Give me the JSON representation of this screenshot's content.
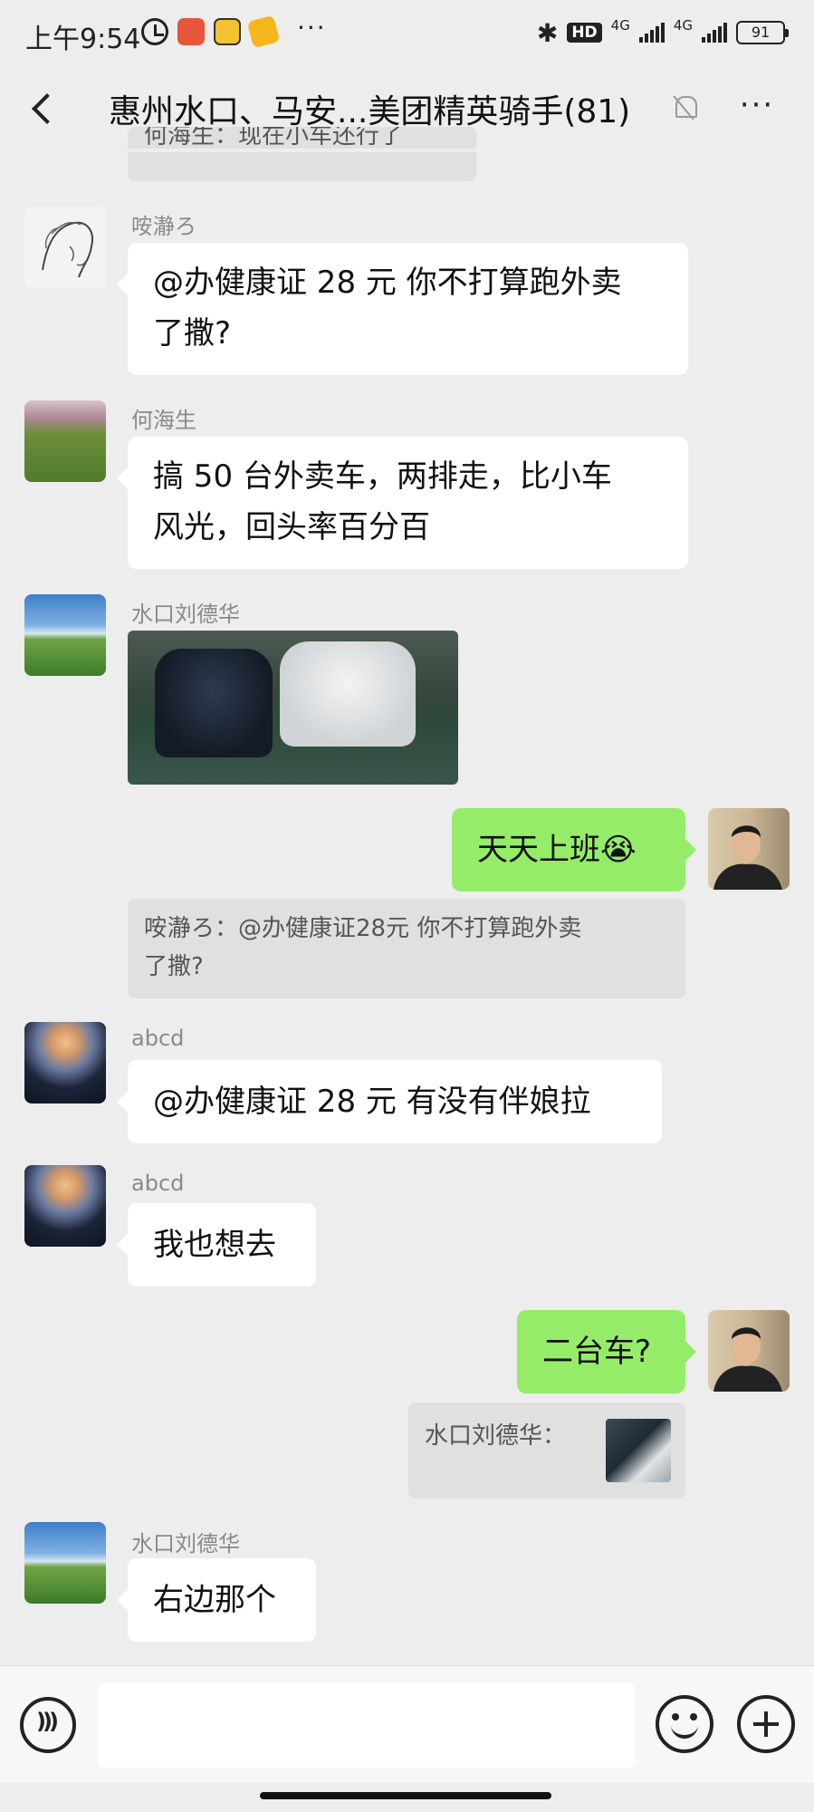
{
  "status_bar": {
    "time": "上午9:54",
    "more": "···",
    "network": "HD",
    "signal1": "4G",
    "signal2": "4G",
    "battery": "91"
  },
  "header": {
    "title": "惠州水口、马安...美团精英骑手(81)"
  },
  "messages": {
    "m0_quote": "何海生：现在小车还行了",
    "m1_sender": "咹瀞ろ",
    "m1_text_line1": "@办健康证 28 元  你不打算跑外卖",
    "m1_text_line2": "了撒?",
    "m2_sender": "何海生",
    "m2_text_line1": "搞 50 台外卖车，两排走，比小车",
    "m2_text_line2": "风光，回头率百分百",
    "m3_sender": "水口刘德华",
    "m4_text": "天天上班😭",
    "m4_quote_line1": "咹瀞ろ：@办健康证28元 你不打算跑外卖",
    "m4_quote_line2": "了撒?",
    "m5_sender": "abcd",
    "m5_text": "@办健康证 28 元  有没有伴娘拉",
    "m6_sender": "abcd",
    "m6_text": "我也想去",
    "m7_text": "二台车?",
    "m7_quote": "水口刘德华：",
    "m8_sender": "水口刘德华",
    "m8_text": "右边那个"
  },
  "input": {
    "placeholder": ""
  },
  "colors": {
    "background": "#ededed",
    "incoming_bubble": "#ffffff",
    "outgoing_bubble": "#95ec69",
    "quote_bg": "#e0e0e0"
  }
}
